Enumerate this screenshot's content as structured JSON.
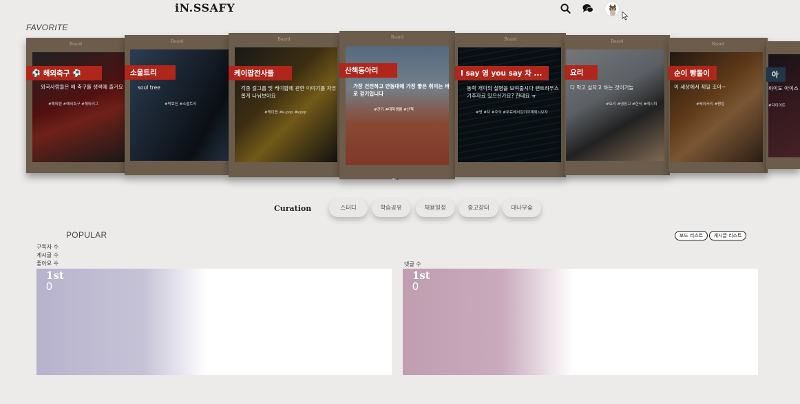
{
  "header": {
    "logo": "iN.SSAFY",
    "icons": {
      "search": "search-icon",
      "chat": "chat-bubble-icon",
      "avatar": "cat-avatar-icon"
    }
  },
  "favorite": {
    "label": "FAVORITE",
    "board_caption": "Board",
    "cards": [
      {
        "title": "⚽ 해외축구 ⚽",
        "desc": "외국사람들은 왜 축구를 생색에 즐거요",
        "tags": "#해외팬 #해외축구 #해외리그"
      },
      {
        "title": "소울트리",
        "desc": "soul tree",
        "tags": "#박효진 #소울트리"
      },
      {
        "title": "케이팝전사들",
        "desc": "각종 걸그룹 및 케이팝에 관한 이야기를 자유롭게 나눠보아요",
        "tags": "#케이팝 #k-pop #kpop"
      },
      {
        "title": "산책동아리",
        "desc": "가장 건전하고 안동대에 가장 좋은 취미는 바로 걷기입니다",
        "tags": "#건기 #대학생활 #산책"
      },
      {
        "title": "I say 영 you say 차 ...",
        "desc": "동학 개미의 설명을 보여줍시다 랜트하우스 기주자료 있으신가요? 한테요 ㅠ",
        "tags": "#영 #차 #주식 #무료에서김이이제제시보자"
      },
      {
        "title": "요리",
        "desc": "다 먹고 살자고 하는 것이거늘",
        "tags": "#요리 #냉장고 #한식 #레시피"
      },
      {
        "title": "순이 빵돌이",
        "desc": "이 세상에서 제일 조아~",
        "tags": "#베이커리 #빵집"
      },
      {
        "title": "아",
        "desc": "하이도 아이스 아",
        "tags": "#다이어트"
      }
    ]
  },
  "curation": {
    "title": "Curation",
    "chips": [
      "스터디",
      "학습공유",
      "채용일정",
      "중고장터",
      "대나무숲"
    ]
  },
  "popular": {
    "label": "POPULAR",
    "buttons": {
      "board_list": "보드 리스트",
      "post_list": "게시글 리스트"
    },
    "left_stats": [
      "구독자 수",
      "게시글 수",
      "좋아요 수"
    ],
    "right_stat": "댓글 수",
    "cards": [
      {
        "rank": "1st",
        "count": "0",
        "color": "#b7b3cd"
      },
      {
        "rank": "1st",
        "count": "0",
        "color": "#bf9eb0"
      }
    ]
  }
}
